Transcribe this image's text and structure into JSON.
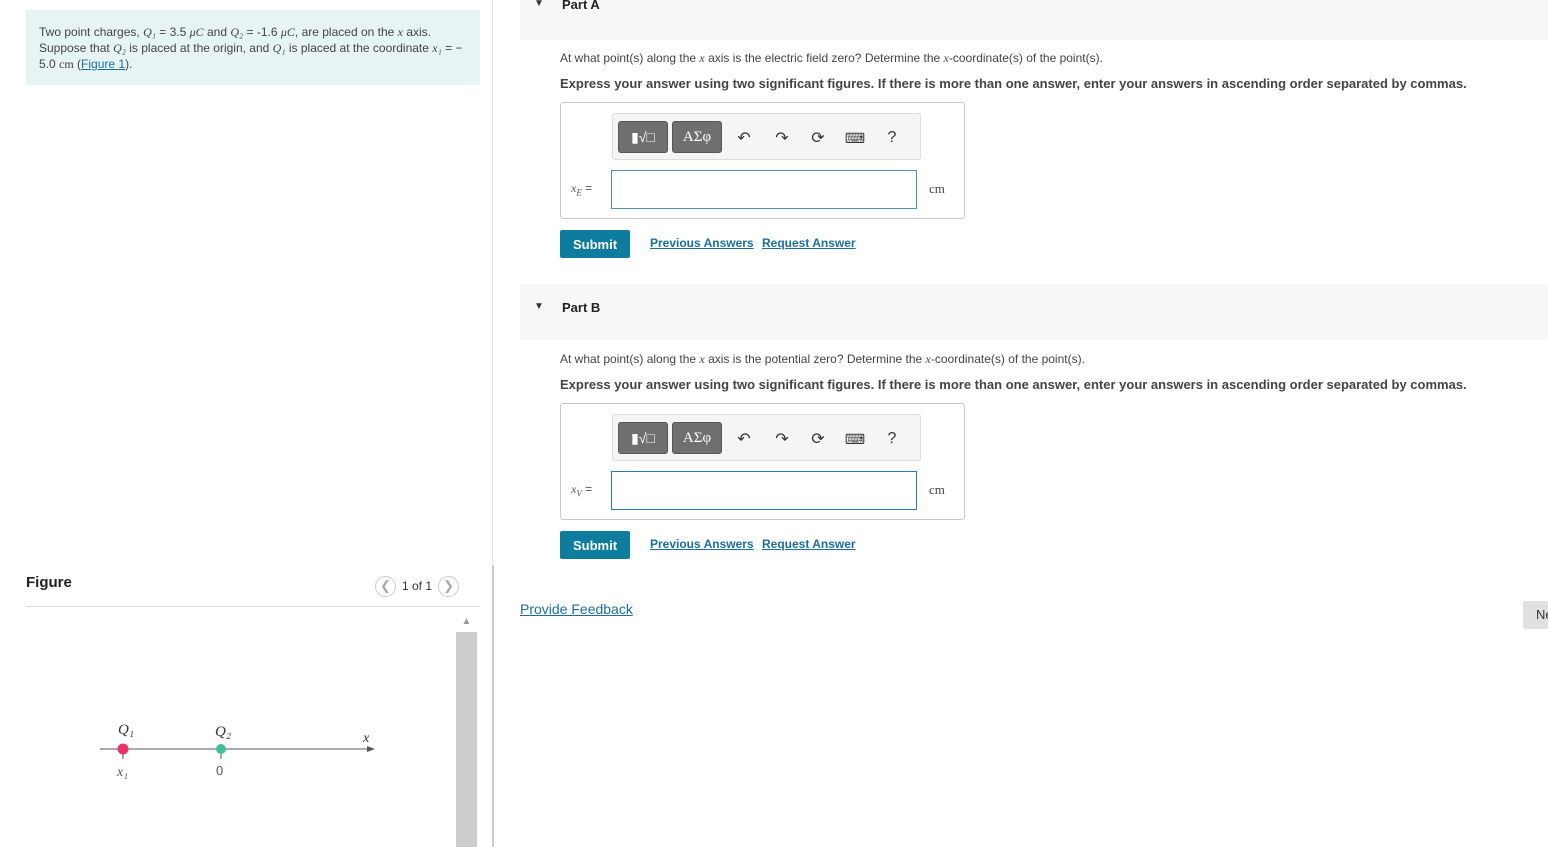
{
  "problem": {
    "text_a": "Two point charges, ",
    "q1": "Q₁",
    "eq1": " = 3.5 ",
    "unit_uc": "μC",
    "text_b": " and ",
    "q2": "Q₂",
    "eq2": " = -1.6 ",
    "unit_uc2": "μC",
    "text_c": ", are placed on the ",
    "x_axis_var": "x",
    "text_d": " axis. Suppose that ",
    "q2b": "Q₂",
    "text_e": " is placed at the origin, and ",
    "q1b": "Q₁",
    "text_f": " is placed at the coordinate ",
    "x1": "x₁",
    "eq3": " = − 5.0 ",
    "unit_cm": "cm",
    "text_g": " (",
    "figure_link": "Figure 1",
    "text_h": ")."
  },
  "figure": {
    "title": "Figure",
    "pager": "1 of 1",
    "labels": {
      "q1": "Q₁",
      "q2": "Q₂",
      "axis": "x",
      "x1": "x₁",
      "origin": "0"
    },
    "colors": {
      "q1": "#e8336a",
      "q2": "#3dbf9a"
    }
  },
  "parts": [
    {
      "label": "Part A",
      "question_a": "At what point(s) along the ",
      "question_var": "x",
      "question_b": " axis is the electric field zero? Determine the ",
      "question_var2": "x",
      "question_c": "-coordinate(s) of the point(s).",
      "instruction": "Express your answer using two significant figures. If there is more than one answer, enter your answers in ascending order separated by commas.",
      "var_label": "x",
      "var_sub": "E",
      "value": "",
      "unit": "cm",
      "submit": "Submit",
      "prev": "Previous Answers",
      "request": "Request Answer"
    },
    {
      "label": "Part B",
      "question_a": "At what point(s) along the ",
      "question_var": "x",
      "question_b": " axis is the potential zero? Determine the ",
      "question_var2": "x",
      "question_c": "-coordinate(s) of the point(s).",
      "instruction": "Express your answer using two significant figures. If there is more than one answer, enter your answers in ascending order separated by commas.",
      "var_label": "x",
      "var_sub": "V",
      "value": "",
      "unit": "cm",
      "submit": "Submit",
      "prev": "Previous Answers",
      "request": "Request Answer"
    }
  ],
  "toolbar": {
    "greek": "ΑΣφ",
    "help": "?"
  },
  "feedback": "Provide Feedback",
  "next": "Ne"
}
